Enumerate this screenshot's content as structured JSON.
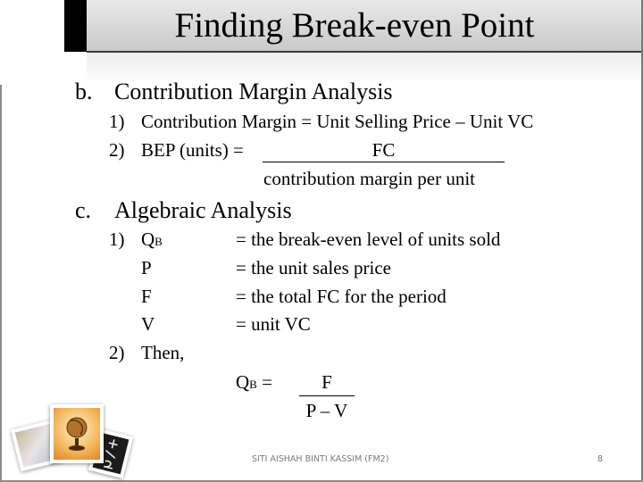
{
  "slide": {
    "title": "Finding Break-even Point",
    "sections": [
      {
        "marker": "b.",
        "heading": "Contribution Margin Analysis",
        "items": [
          {
            "num": "1)",
            "text": "Contribution Margin = Unit Selling Price – Unit VC"
          },
          {
            "num": "2)",
            "label": "BEP (units) =",
            "numerator": "FC",
            "denominator": "contribution margin per unit"
          }
        ]
      },
      {
        "marker": "c.",
        "heading": "Algebraic Analysis",
        "definitions_num": "1)",
        "definitions": [
          {
            "symbol": "Q",
            "subscript": "B",
            "meaning": "= the break-even level of units sold"
          },
          {
            "symbol": "P",
            "subscript": "",
            "meaning": "= the unit sales price"
          },
          {
            "symbol": "F",
            "subscript": "",
            "meaning": "= the total FC for the period"
          },
          {
            "symbol": "V",
            "subscript": "",
            "meaning": "= unit VC"
          }
        ],
        "then_num": "2)",
        "then_text": "Then,",
        "formula": {
          "lhs_symbol": "Q",
          "lhs_subscript": "B",
          "equals": "=",
          "numerator": "F",
          "denominator": "P – V"
        }
      }
    ],
    "decorative_image": "photo-collage-icon"
  },
  "footer": {
    "author": "SITI AISHAH BINTI KASSIM (FM2)",
    "page_number": "8"
  }
}
